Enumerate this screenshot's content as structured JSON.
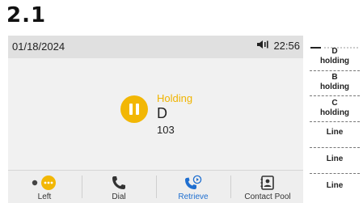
{
  "section": {
    "label": "2.1"
  },
  "status_bar": {
    "date": "01/18/2024",
    "time": "22:56",
    "icon": "speaker-volume-icon"
  },
  "call": {
    "status": "Holding",
    "name": "D",
    "number": "103",
    "status_color": "#f0b400",
    "hold_icon": "pause-circle-icon"
  },
  "softkeys": [
    {
      "label": "Left",
      "icon": "more-dots-icon"
    },
    {
      "label": "Dial",
      "icon": "phone-handset-icon"
    },
    {
      "label": "Retrieve",
      "icon": "phone-retrieve-icon",
      "active": true
    },
    {
      "label": "Contact Pool",
      "icon": "contact-book-icon"
    }
  ],
  "line_keys": [
    {
      "line1": "D",
      "line2": "holding"
    },
    {
      "line1": "B",
      "line2": "holding"
    },
    {
      "line1": "C",
      "line2": "holding"
    },
    {
      "line1": "Line",
      "line2": ""
    },
    {
      "line1": "Line",
      "line2": ""
    },
    {
      "line1": "Line",
      "line2": ""
    }
  ],
  "colors": {
    "accent": "#1f6fd0",
    "hold": "#f2b705"
  }
}
